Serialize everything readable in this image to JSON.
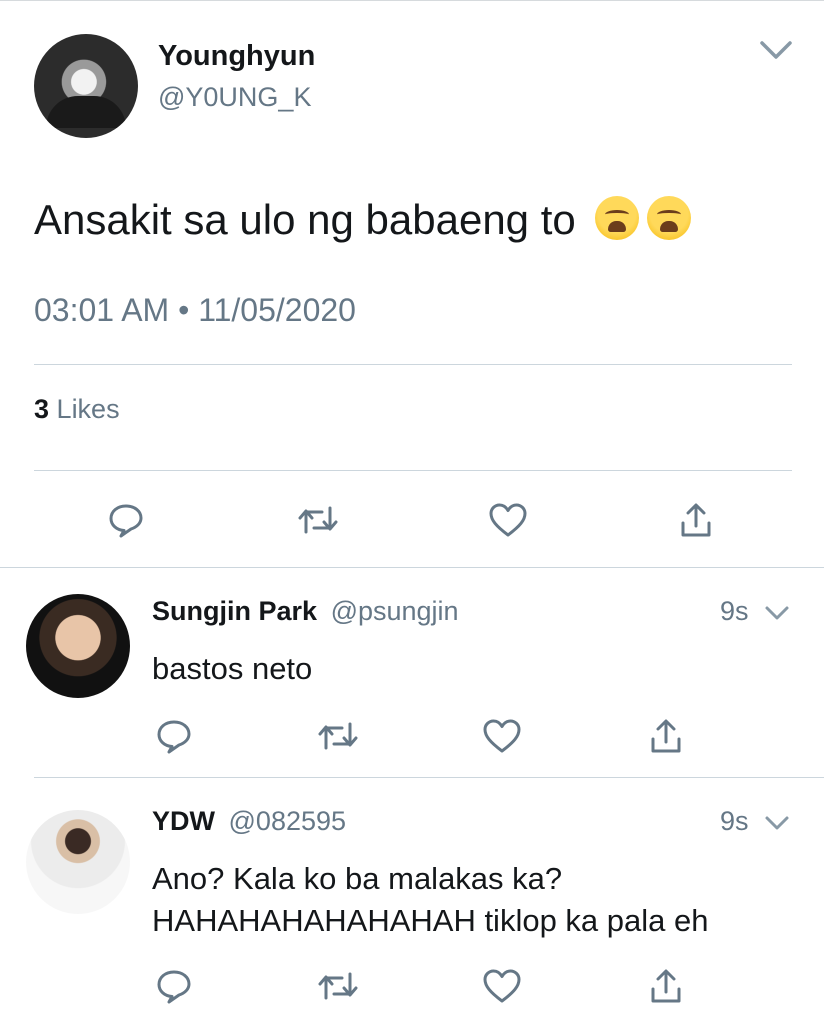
{
  "main_tweet": {
    "author_name": "Younghyun",
    "author_handle": "@Y0UNG_K",
    "text": "Ansakit sa ulo ng babaeng to",
    "emojis": [
      "weary-face-icon",
      "weary-face-icon"
    ],
    "time": "03:01 AM",
    "separator": "•",
    "date": "11/05/2020",
    "likes_count": "3",
    "likes_label": "Likes"
  },
  "replies": [
    {
      "name": "Sungjin Park",
      "handle": "@psungjin",
      "time": "9s",
      "lines": [
        "bastos neto"
      ]
    },
    {
      "name": "YDW",
      "handle": "@082595",
      "time": "9s",
      "lines": [
        "Ano? Kala ko ba malakas ka?",
        "HAHAHAHAHAHAHAH tiklop ka pala eh"
      ]
    }
  ],
  "icons": {
    "reply": "reply-icon",
    "retweet": "retweet-icon",
    "like": "heart-icon",
    "share": "share-icon",
    "menu": "chevron-down-icon"
  },
  "colors": {
    "text": "#14171a",
    "secondary": "#657786",
    "divider": "#ccd6dd"
  }
}
